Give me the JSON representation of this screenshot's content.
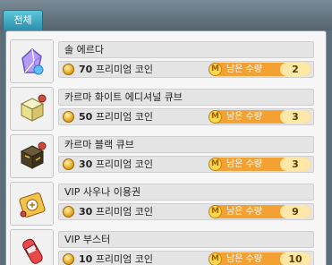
{
  "tabs": [
    {
      "label": "전체"
    }
  ],
  "items": [
    {
      "name": "솔 에르다",
      "price": "70",
      "currency": "프리미엄 코인",
      "qty_label": "남은 수량",
      "qty": "2",
      "icon": "sol-erda-icon"
    },
    {
      "name": "카르마 화이트 에디셔널 큐브",
      "price": "50",
      "currency": "프리미엄 코인",
      "qty_label": "남은 수량",
      "qty": "3",
      "icon": "white-additional-cube-icon"
    },
    {
      "name": "카르마 블랙 큐브",
      "price": "30",
      "currency": "프리미엄 코인",
      "qty_label": "남은 수량",
      "qty": "3",
      "icon": "black-cube-icon"
    },
    {
      "name": "VIP 사우나 이용권",
      "price": "30",
      "currency": "프리미엄 코인",
      "qty_label": "남은 수량",
      "qty": "9",
      "icon": "sauna-ticket-icon"
    },
    {
      "name": "VIP 부스터",
      "price": "10",
      "currency": "프리미엄 코인",
      "qty_label": "남은 수량",
      "qty": "10",
      "icon": "vip-booster-icon"
    }
  ],
  "badge_letter": "M",
  "colors": {
    "tab": "#3aa9c4",
    "qty_bar": "#f3a132",
    "coin": "#e6a91e"
  }
}
